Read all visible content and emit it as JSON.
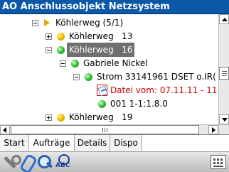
{
  "app": {
    "title": "AO Anschlussobjekt Netzsystem"
  },
  "tree": {
    "nodes": [
      {
        "label": "Köhlerweg (5/1)",
        "icon": "folder-arrow-icon",
        "expander": "minus",
        "status": ""
      },
      {
        "label": "Köhlerweg   13",
        "icon": "status-dot-icon",
        "expander": "plus",
        "status": "yellow"
      },
      {
        "label": "Köhlerweg   16",
        "icon": "status-dot-icon",
        "expander": "minus",
        "status": "green",
        "selected": true
      },
      {
        "label": "Gabriele Nickel",
        "icon": "status-dot-icon",
        "expander": "minus",
        "status": "green"
      },
      {
        "label": "Strom 33141961 DSET o.IR(",
        "icon": "status-dot-icon",
        "expander": "minus",
        "status": "green"
      },
      {
        "label": "Datei vom: 07.11.11 - 11",
        "icon": "document-icon",
        "expander": "none",
        "status": "red"
      },
      {
        "label": "001 1-1:1.8.0",
        "icon": "status-dot-icon",
        "expander": "none",
        "status": "green"
      },
      {
        "label": "Köhlerweg   19",
        "icon": "status-dot-icon",
        "expander": "plus",
        "status": "yellow"
      }
    ]
  },
  "tabs": [
    {
      "label": "Start",
      "active": false
    },
    {
      "label": "Aufträge",
      "active": true
    },
    {
      "label": "Details",
      "active": false
    },
    {
      "label": "Dispo",
      "active": false
    }
  ],
  "toolbar": {
    "icons": [
      "wrench-icon",
      "paperclip-icon",
      "magnifier-icon",
      "spellcheck-icon",
      "keyboard-icon"
    ],
    "spellcheck_text": "ABC"
  },
  "colors": {
    "titlebar": "#0b58a8",
    "selection": "#6f6f6f",
    "alert_text": "#d00000",
    "status_yellow": "#f2c200",
    "status_green": "#3cc23c"
  }
}
